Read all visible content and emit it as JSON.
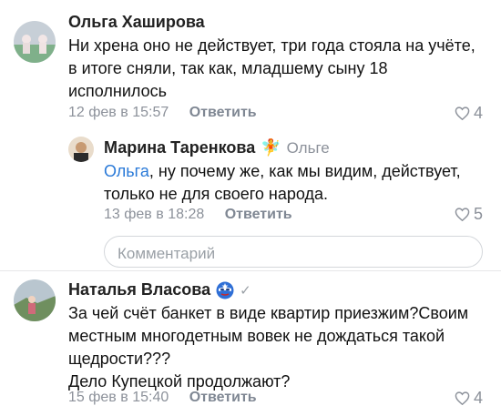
{
  "comments": [
    {
      "author": "Ольга Хаширова",
      "lines": [
        "Ни хрена оно не действует, три года стояла на учёте,",
        "в итоге сняли, так как, младшему сыну 18",
        "исполнилось"
      ],
      "time": "12 фев в 15:57",
      "reply_label": "Ответить",
      "likes": "4"
    },
    {
      "author": "Марина Таренкова",
      "emoji": "🧚",
      "reply_to": "Ольге",
      "mention": "Ольга",
      "lines": [
        ", ну почему же, как мы  видим, действует,",
        "только не для своего народа."
      ],
      "time": "13 фев в 18:28",
      "reply_label": "Ответить",
      "likes": "5"
    },
    {
      "author": "Наталья Власова",
      "verified_mark": "✓",
      "lines": [
        "За чей счёт банкет в виде квартир приезжим?Своим",
        "местным многодетным вовек не дождаться такой",
        "щедрости???",
        "Дело Купецкой продолжают?"
      ],
      "time": "15 фев в 15:40",
      "reply_label": "Ответить",
      "likes": "4"
    }
  ],
  "comment_input": {
    "placeholder": "Комментарий"
  },
  "colors": {
    "link": "#2a7ad8",
    "meta": "#8c919a",
    "border": "#d4d7db"
  },
  "icons": [
    "heart-icon",
    "fairy-emoji-icon",
    "captain-america-mask-icon",
    "verified-check-icon"
  ]
}
